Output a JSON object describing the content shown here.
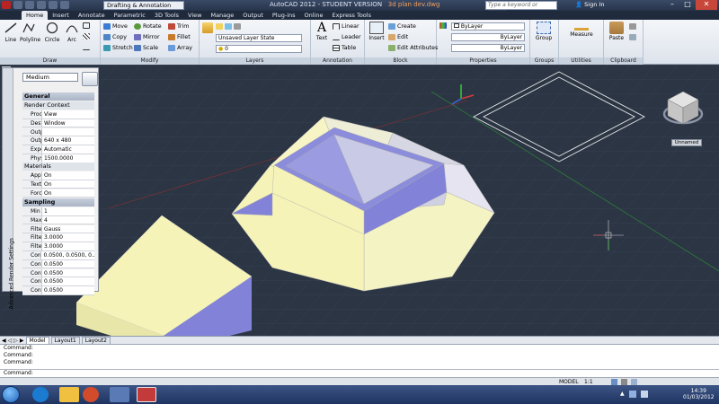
{
  "titlebar": {
    "app_title": "AutoCAD 2012 - STUDENT VERSION",
    "file_name": "3d plan dev.dwg",
    "workspace": "Drafting & Annotation",
    "search_placeholder": "Type a keyword or phrase",
    "sign_in": "Sign In"
  },
  "tabs": [
    "Home",
    "Insert",
    "Annotate",
    "Parametric",
    "3D Tools",
    "View",
    "Manage",
    "Output",
    "Plug-ins",
    "Online",
    "Express Tools"
  ],
  "ribbon": {
    "draw": {
      "label": "Draw",
      "line": "Line",
      "polyline": "Polyline",
      "circle": "Circle",
      "arc": "Arc"
    },
    "modify": {
      "label": "Modify",
      "move": "Move",
      "rotate": "Rotate",
      "trim": "Trim",
      "copy": "Copy",
      "mirror": "Mirror",
      "fillet": "Fillet",
      "stretch": "Stretch",
      "scale": "Scale",
      "array": "Array"
    },
    "layers": {
      "label": "Layers",
      "layer_state": "Unsaved Layer State",
      "current_layer": "0"
    },
    "annotation": {
      "label": "Annotation",
      "text": "Text",
      "linear": "Linear",
      "leader": "Leader",
      "table": "Table"
    },
    "block": {
      "label": "Block",
      "insert": "Insert",
      "create": "Create",
      "edit": "Edit",
      "edit_attributes": "Edit Attributes"
    },
    "properties": {
      "label": "Properties",
      "color": "ByLayer",
      "linetype": "ByLayer",
      "lineweight": "ByLayer"
    },
    "groups": {
      "label": "Groups",
      "group": "Group"
    },
    "utilities": {
      "label": "Utilities",
      "measure": "Measure"
    },
    "clipboard": {
      "label": "Clipboard",
      "paste": "Paste"
    }
  },
  "palette": {
    "preset": "Medium",
    "side_title": "Advanced Render Settings",
    "sections": {
      "general": "General",
      "render_context": "Render Context",
      "materials": "Materials",
      "sampling": "Sampling"
    },
    "render_context_rows": [
      {
        "k": "Proce...",
        "v": "View"
      },
      {
        "k": "Destin...",
        "v": "Window"
      },
      {
        "k": "Outp...",
        "v": ""
      },
      {
        "k": "Outp...",
        "v": "640 x 480"
      },
      {
        "k": "Expo...",
        "v": "Automatic"
      },
      {
        "k": "Physi...",
        "v": "1500.0000"
      }
    ],
    "materials_rows": [
      {
        "k": "Appl...",
        "v": "On"
      },
      {
        "k": "Textu...",
        "v": "On"
      },
      {
        "k": "Force...",
        "v": "On"
      }
    ],
    "sampling_rows": [
      {
        "k": "Min s...",
        "v": "1"
      },
      {
        "k": "Max s...",
        "v": "4"
      },
      {
        "k": "Filter...",
        "v": "Gauss"
      },
      {
        "k": "Filter...",
        "v": "3.0000"
      },
      {
        "k": "Filter...",
        "v": "3.0000"
      },
      {
        "k": "Contr...",
        "v": "0.0500, 0.0500, 0..."
      },
      {
        "k": "Contr...",
        "v": "0.0500"
      },
      {
        "k": "Contr...",
        "v": "0.0500"
      },
      {
        "k": "Contr...",
        "v": "0.0500"
      },
      {
        "k": "Contr...",
        "v": "0.0500"
      }
    ]
  },
  "viewcube": {
    "label": "Unnamed"
  },
  "layout_tabs": [
    "Model",
    "Layout1",
    "Layout2"
  ],
  "command": {
    "history": [
      "Command:",
      "Command:",
      "Command:"
    ],
    "prompt": "Command:"
  },
  "status": {
    "coords": "",
    "model": "MODEL",
    "scale": "1:1"
  },
  "taskbar": {
    "time": "14:39",
    "date": "01/03/2012"
  },
  "colors": {
    "face_light": "#f5f3b8",
    "face_dark": "#8283d8",
    "background": "#2b3544"
  }
}
